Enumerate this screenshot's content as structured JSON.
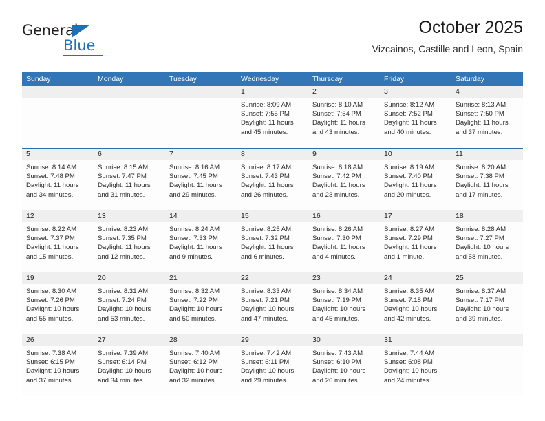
{
  "brand": {
    "name_top": "General",
    "name_bottom": "Blue",
    "accent_color": "#2272b9"
  },
  "header": {
    "title": "October 2025",
    "subtitle": "Vizcainos, Castille and Leon, Spain"
  },
  "theme": {
    "header_row_bg": "#3276b8",
    "week_divider": "#2e6dab",
    "day_number_bg": "#efefef",
    "cell_bg": "#fdfdfd",
    "text": "#2a2a2a"
  },
  "weekdays": [
    "Sunday",
    "Monday",
    "Tuesday",
    "Wednesday",
    "Thursday",
    "Friday",
    "Saturday"
  ],
  "labels": {
    "sunrise": "Sunrise:",
    "sunset": "Sunset:",
    "daylight": "Daylight:"
  },
  "weeks": [
    [
      {
        "day": "",
        "empty": true
      },
      {
        "day": "",
        "empty": true
      },
      {
        "day": "",
        "empty": true
      },
      {
        "day": "1",
        "sunrise": "Sunrise: 8:09 AM",
        "sunset": "Sunset: 7:55 PM",
        "daylight1": "Daylight: 11 hours",
        "daylight2": "and 45 minutes."
      },
      {
        "day": "2",
        "sunrise": "Sunrise: 8:10 AM",
        "sunset": "Sunset: 7:54 PM",
        "daylight1": "Daylight: 11 hours",
        "daylight2": "and 43 minutes."
      },
      {
        "day": "3",
        "sunrise": "Sunrise: 8:12 AM",
        "sunset": "Sunset: 7:52 PM",
        "daylight1": "Daylight: 11 hours",
        "daylight2": "and 40 minutes."
      },
      {
        "day": "4",
        "sunrise": "Sunrise: 8:13 AM",
        "sunset": "Sunset: 7:50 PM",
        "daylight1": "Daylight: 11 hours",
        "daylight2": "and 37 minutes."
      }
    ],
    [
      {
        "day": "5",
        "sunrise": "Sunrise: 8:14 AM",
        "sunset": "Sunset: 7:48 PM",
        "daylight1": "Daylight: 11 hours",
        "daylight2": "and 34 minutes."
      },
      {
        "day": "6",
        "sunrise": "Sunrise: 8:15 AM",
        "sunset": "Sunset: 7:47 PM",
        "daylight1": "Daylight: 11 hours",
        "daylight2": "and 31 minutes."
      },
      {
        "day": "7",
        "sunrise": "Sunrise: 8:16 AM",
        "sunset": "Sunset: 7:45 PM",
        "daylight1": "Daylight: 11 hours",
        "daylight2": "and 29 minutes."
      },
      {
        "day": "8",
        "sunrise": "Sunrise: 8:17 AM",
        "sunset": "Sunset: 7:43 PM",
        "daylight1": "Daylight: 11 hours",
        "daylight2": "and 26 minutes."
      },
      {
        "day": "9",
        "sunrise": "Sunrise: 8:18 AM",
        "sunset": "Sunset: 7:42 PM",
        "daylight1": "Daylight: 11 hours",
        "daylight2": "and 23 minutes."
      },
      {
        "day": "10",
        "sunrise": "Sunrise: 8:19 AM",
        "sunset": "Sunset: 7:40 PM",
        "daylight1": "Daylight: 11 hours",
        "daylight2": "and 20 minutes."
      },
      {
        "day": "11",
        "sunrise": "Sunrise: 8:20 AM",
        "sunset": "Sunset: 7:38 PM",
        "daylight1": "Daylight: 11 hours",
        "daylight2": "and 17 minutes."
      }
    ],
    [
      {
        "day": "12",
        "sunrise": "Sunrise: 8:22 AM",
        "sunset": "Sunset: 7:37 PM",
        "daylight1": "Daylight: 11 hours",
        "daylight2": "and 15 minutes."
      },
      {
        "day": "13",
        "sunrise": "Sunrise: 8:23 AM",
        "sunset": "Sunset: 7:35 PM",
        "daylight1": "Daylight: 11 hours",
        "daylight2": "and 12 minutes."
      },
      {
        "day": "14",
        "sunrise": "Sunrise: 8:24 AM",
        "sunset": "Sunset: 7:33 PM",
        "daylight1": "Daylight: 11 hours",
        "daylight2": "and 9 minutes."
      },
      {
        "day": "15",
        "sunrise": "Sunrise: 8:25 AM",
        "sunset": "Sunset: 7:32 PM",
        "daylight1": "Daylight: 11 hours",
        "daylight2": "and 6 minutes."
      },
      {
        "day": "16",
        "sunrise": "Sunrise: 8:26 AM",
        "sunset": "Sunset: 7:30 PM",
        "daylight1": "Daylight: 11 hours",
        "daylight2": "and 4 minutes."
      },
      {
        "day": "17",
        "sunrise": "Sunrise: 8:27 AM",
        "sunset": "Sunset: 7:29 PM",
        "daylight1": "Daylight: 11 hours",
        "daylight2": "and 1 minute."
      },
      {
        "day": "18",
        "sunrise": "Sunrise: 8:28 AM",
        "sunset": "Sunset: 7:27 PM",
        "daylight1": "Daylight: 10 hours",
        "daylight2": "and 58 minutes."
      }
    ],
    [
      {
        "day": "19",
        "sunrise": "Sunrise: 8:30 AM",
        "sunset": "Sunset: 7:26 PM",
        "daylight1": "Daylight: 10 hours",
        "daylight2": "and 55 minutes."
      },
      {
        "day": "20",
        "sunrise": "Sunrise: 8:31 AM",
        "sunset": "Sunset: 7:24 PM",
        "daylight1": "Daylight: 10 hours",
        "daylight2": "and 53 minutes."
      },
      {
        "day": "21",
        "sunrise": "Sunrise: 8:32 AM",
        "sunset": "Sunset: 7:22 PM",
        "daylight1": "Daylight: 10 hours",
        "daylight2": "and 50 minutes."
      },
      {
        "day": "22",
        "sunrise": "Sunrise: 8:33 AM",
        "sunset": "Sunset: 7:21 PM",
        "daylight1": "Daylight: 10 hours",
        "daylight2": "and 47 minutes."
      },
      {
        "day": "23",
        "sunrise": "Sunrise: 8:34 AM",
        "sunset": "Sunset: 7:19 PM",
        "daylight1": "Daylight: 10 hours",
        "daylight2": "and 45 minutes."
      },
      {
        "day": "24",
        "sunrise": "Sunrise: 8:35 AM",
        "sunset": "Sunset: 7:18 PM",
        "daylight1": "Daylight: 10 hours",
        "daylight2": "and 42 minutes."
      },
      {
        "day": "25",
        "sunrise": "Sunrise: 8:37 AM",
        "sunset": "Sunset: 7:17 PM",
        "daylight1": "Daylight: 10 hours",
        "daylight2": "and 39 minutes."
      }
    ],
    [
      {
        "day": "26",
        "sunrise": "Sunrise: 7:38 AM",
        "sunset": "Sunset: 6:15 PM",
        "daylight1": "Daylight: 10 hours",
        "daylight2": "and 37 minutes."
      },
      {
        "day": "27",
        "sunrise": "Sunrise: 7:39 AM",
        "sunset": "Sunset: 6:14 PM",
        "daylight1": "Daylight: 10 hours",
        "daylight2": "and 34 minutes."
      },
      {
        "day": "28",
        "sunrise": "Sunrise: 7:40 AM",
        "sunset": "Sunset: 6:12 PM",
        "daylight1": "Daylight: 10 hours",
        "daylight2": "and 32 minutes."
      },
      {
        "day": "29",
        "sunrise": "Sunrise: 7:42 AM",
        "sunset": "Sunset: 6:11 PM",
        "daylight1": "Daylight: 10 hours",
        "daylight2": "and 29 minutes."
      },
      {
        "day": "30",
        "sunrise": "Sunrise: 7:43 AM",
        "sunset": "Sunset: 6:10 PM",
        "daylight1": "Daylight: 10 hours",
        "daylight2": "and 26 minutes."
      },
      {
        "day": "31",
        "sunrise": "Sunrise: 7:44 AM",
        "sunset": "Sunset: 6:08 PM",
        "daylight1": "Daylight: 10 hours",
        "daylight2": "and 24 minutes."
      },
      {
        "day": "",
        "empty": true
      }
    ]
  ]
}
